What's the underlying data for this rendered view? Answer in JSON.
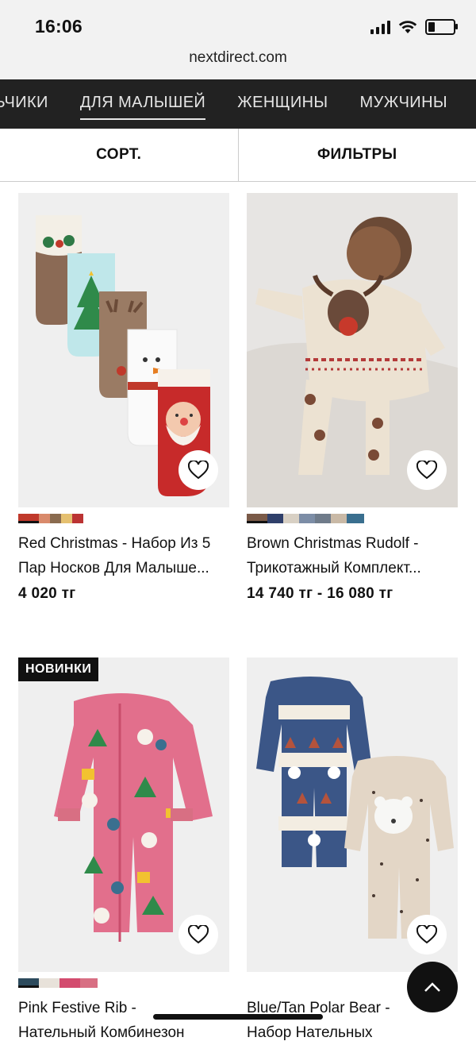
{
  "status_bar": {
    "time": "16:06"
  },
  "browser": {
    "address": "nextdirect.com"
  },
  "category_nav": {
    "items": [
      {
        "label": "ЛЬЧИКИ",
        "active": false
      },
      {
        "label": "ДЛЯ МАЛЫШЕЙ",
        "active": true
      },
      {
        "label": "ЖЕНЩИНЫ",
        "active": false
      },
      {
        "label": "МУЖЧИНЫ",
        "active": false
      }
    ]
  },
  "toolbar": {
    "sort_label": "СОРТ.",
    "filter_label": "ФИЛЬТРЫ"
  },
  "products": [
    {
      "title_line1": "Red Christmas - Набор Из 5",
      "title_line2": "Пар Носков Для Малыше...",
      "price": "4 020 тг",
      "badge": "",
      "swatch_colors": [
        "#c0392b",
        "#d98a6b",
        "#8a6b4f",
        "#e5c070",
        "#b33"
      ]
    },
    {
      "title_line1": "Brown Christmas Rudolf -",
      "title_line2": "Трикотажный Комплект...",
      "price": "14 740 тг - 16 080 тг",
      "badge": "",
      "swatch_colors": [
        "#7a5a48",
        "#2f3f6a",
        "#d8d0c4",
        "#7c8da6",
        "#6f7b8a",
        "#c9b9a6",
        "#3a6f8f"
      ]
    },
    {
      "title_line1": "Pink Festive Rib -",
      "title_line2": "Нательный Комбинезон",
      "price": "",
      "badge": "НОВИНКИ",
      "swatch_colors": [
        "#2c4a5c",
        "#e8e2da",
        "#d34b6e",
        "#d86f83"
      ]
    },
    {
      "title_line1": "Blue/Tan Polar Bear -",
      "title_line2": "Набор Нательных",
      "price": "",
      "badge": "",
      "swatch_colors": []
    }
  ],
  "icons": {
    "favorite": "heart-outline-icon",
    "scroll_top": "chevron-up-icon",
    "wifi": "wifi-icon",
    "signal": "cellular-signal-icon",
    "battery": "battery-icon"
  }
}
